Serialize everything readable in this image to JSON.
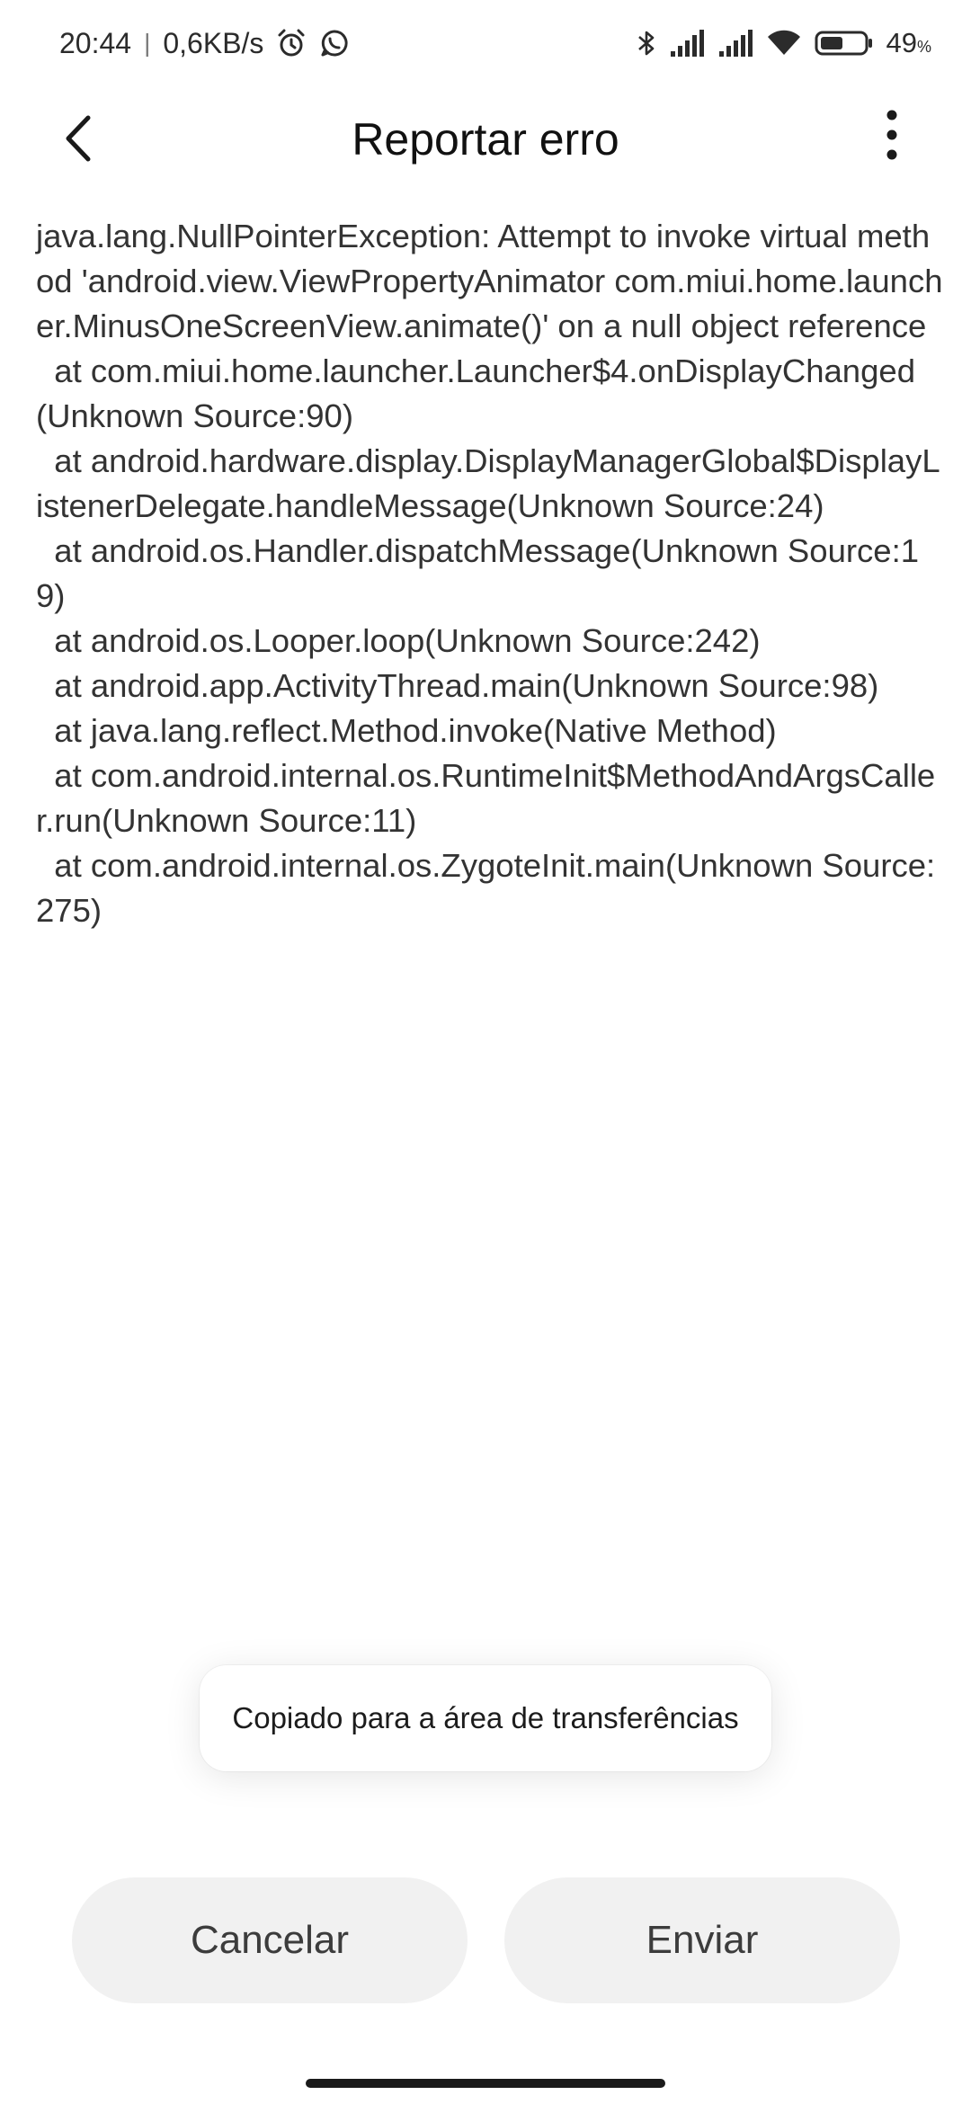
{
  "status_bar": {
    "time": "20:44",
    "separator": "|",
    "network_speed": "0,6KB/s",
    "left_icons": [
      "alarm-icon",
      "whatsapp-icon"
    ],
    "right_icons": [
      "bluetooth-icon",
      "signal-icon",
      "signal-icon",
      "wifi-icon",
      "battery-icon"
    ],
    "battery_percent": "49",
    "battery_unit": "%",
    "battery_level": 0.49
  },
  "header": {
    "back_icon": "chevron-left-icon",
    "title": "Reportar erro",
    "more_icon": "more-vertical-icon"
  },
  "error_log": "java.lang.NullPointerException: Attempt to invoke virtual method 'android.view.ViewPropertyAnimator com.miui.home.launcher.MinusOneScreenView.animate()' on a null object reference\n  at com.miui.home.launcher.Launcher$4.onDisplayChanged(Unknown Source:90)\n  at android.hardware.display.DisplayManagerGlobal$DisplayListenerDelegate.handleMessage(Unknown Source:24)\n  at android.os.Handler.dispatchMessage(Unknown Source:19)\n  at android.os.Looper.loop(Unknown Source:242)\n  at android.app.ActivityThread.main(Unknown Source:98)\n  at java.lang.reflect.Method.invoke(Native Method)\n  at com.android.internal.os.RuntimeInit$MethodAndArgsCaller.run(Unknown Source:11)\n  at com.android.internal.os.ZygoteInit.main(Unknown Source:275)",
  "toast": {
    "message": "Copiado para a área de transferências"
  },
  "actions": {
    "cancel_label": "Cancelar",
    "send_label": "Enviar"
  },
  "colors": {
    "background": "#ffffff",
    "button_bg": "#f1f1f1",
    "text": "#333333"
  }
}
